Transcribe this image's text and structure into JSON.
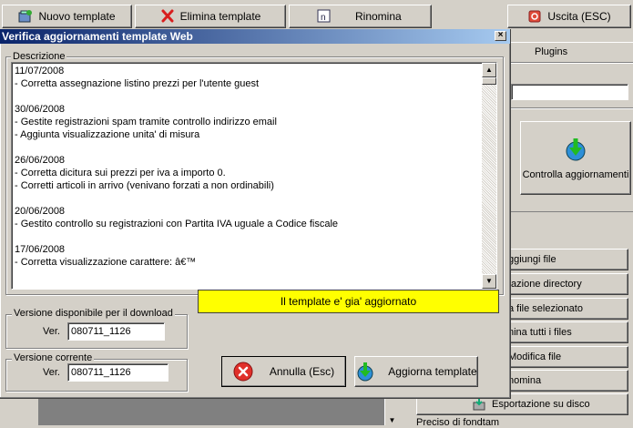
{
  "toolbar": {
    "new_label": "Nuovo template",
    "delete_label": "Elimina template",
    "rename_label": "Rinomina",
    "exit_label": "Uscita (ESC)"
  },
  "right_panel": {
    "plugins_tab": "Plugins",
    "check_updates_label": "Controlla aggiornamenti",
    "buttons": [
      "ggiungi file",
      "tazione directory",
      "a file selezionato",
      "nina tutti i files",
      "Modifica file",
      "nomina",
      "Esportazione su disco"
    ]
  },
  "bottom_strip_text": "Preciso di fondtam",
  "dialog": {
    "title": "Verifica aggiornamenti template Web",
    "close_glyph": "×",
    "description_label": "Descrizione",
    "description_lines": [
      "11/07/2008",
      "- Corretta assegnazione listino prezzi per l'utente guest",
      "",
      "30/06/2008",
      "- Gestite registrazioni spam tramite controllo indirizzo email",
      "- Aggiunta visualizzazione unita' di misura",
      "",
      "26/06/2008",
      "- Corretta dicitura sui prezzi per iva a importo 0.",
      "- Corretti articoli in arrivo (venivano forzati a non ordinabili)",
      "",
      "20/06/2008",
      "- Gestito controllo su registrazioni con Partita IVA uguale a Codice fiscale",
      "",
      "17/06/2008",
      "- Corretta visualizzazione carattere: â€™"
    ],
    "available_version_label": "Versione disponibile per il download",
    "available_ver_prefix": "Ver.",
    "available_version": "080711_1126",
    "current_version_label": "Versione corrente",
    "current_ver_prefix": "Ver.",
    "current_version": "080711_1126",
    "status_message": "Il template e' gia' aggiornato",
    "status_color": "#ffff00",
    "cancel_label": "Annulla (Esc)",
    "update_label": "Aggiorna template"
  },
  "colors": {
    "titlebar_start": "#0a246a",
    "titlebar_end": "#a6caf0",
    "face": "#d4d0c8"
  }
}
